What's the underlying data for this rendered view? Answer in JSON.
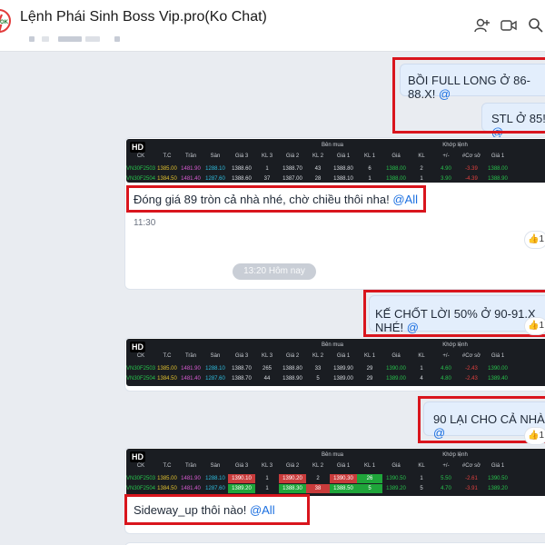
{
  "header": {
    "title": "Lệnh Phái Sinh Boss Vip.pro(Ko Chat)",
    "logo_text": "OK"
  },
  "icons": {
    "add_member": "add-user-icon",
    "video_call": "video-camera-icon",
    "search": "search-icon"
  },
  "divider": {
    "label": "13:20 Hôm nay"
  },
  "messages": {
    "m1": {
      "text": "BỒI FULL LONG Ở 86-88.X!",
      "mention": "@"
    },
    "m2": {
      "text": "STL Ở 85!",
      "mention": "@"
    },
    "m3": {
      "text": "Đóng giá 89 tròn cả nhà nhé, chờ chiều thôi nha!",
      "mention": "@All",
      "time": "11:30"
    },
    "m4": {
      "text": "KẾ CHỐT LỜI 50% Ở 90-91.X NHÉ!",
      "mention": "@"
    },
    "m5": {
      "text": "90 LẠI CHO CẢ NHÀ!",
      "mention": "@"
    },
    "m6": {
      "text": "Sideway_up thôi nào!",
      "mention": "@All"
    }
  },
  "reactions": {
    "count": "1",
    "icon": "thumbs-up-icon"
  },
  "stock_header": {
    "hd": "HD",
    "ck": "CK",
    "tc": "T.C",
    "tran": "Trần",
    "san": "Sàn",
    "ben_mua": "Bên mua",
    "khop_lenh": "Khớp lệnh",
    "gia3": "Giá 3",
    "kl3": "KL 3",
    "gia2": "Giá 2",
    "kl2": "KL 2",
    "gia1": "Giá 1",
    "kl1": "KL 1",
    "gia": "Giá",
    "kl": "KL",
    "pm": "+/-",
    "coso": "#Cơ sở",
    "gia1b": "Giá 1"
  },
  "tables": {
    "t1": [
      [
        "VN30F2503",
        "1385.00",
        "1481.90",
        "1288.10",
        "1388.60",
        "1",
        "1388.70",
        "43",
        "1388.80",
        "6",
        "1388.00",
        "2",
        "4.90",
        "-3.39",
        "1388.00"
      ],
      [
        "VN30F2504",
        "1384.50",
        "1481.40",
        "1287.60",
        "1388.60",
        "37",
        "1387.00",
        "28",
        "1388.10",
        "1",
        "1388.00",
        "1",
        "3.90",
        "-4.39",
        "1388.90"
      ]
    ],
    "t2": [
      [
        "VN30F2503",
        "1385.00",
        "1481.90",
        "1288.10",
        "1388.70",
        "265",
        "1388.80",
        "33",
        "1389.90",
        "29",
        "1390.00",
        "1",
        "4.60",
        "-2.43",
        "1390.00"
      ],
      [
        "VN30F2504",
        "1384.50",
        "1481.40",
        "1287.60",
        "1388.70",
        "44",
        "1388.90",
        "5",
        "1389.00",
        "29",
        "1389.00",
        "4",
        "4.80",
        "-2.43",
        "1389.40"
      ]
    ],
    "t3": [
      [
        "VN30F2503",
        "1385.00",
        "1481.90",
        "1288.10",
        "1390.10",
        "1",
        "1390.20",
        "2",
        "1390.30",
        "26",
        "1390.50",
        "1",
        "5.50",
        "-2.61",
        "1390.50"
      ],
      [
        "VN30F2504",
        "1384.50",
        "1481.40",
        "1287.60",
        "1389.20",
        "1",
        "1388.30",
        "38",
        "1388.50",
        "5",
        "1389.20",
        "5",
        "4.70",
        "-3.91",
        "1389.20"
      ]
    ]
  },
  "colors": {
    "accent": "#1b6fe0",
    "highlight_box": "#d9151d",
    "up": "#27c24c",
    "down": "#e0403f",
    "ceiling": "#d85bd1",
    "reference": "#e0c02f",
    "floor": "#2fbfe0"
  }
}
